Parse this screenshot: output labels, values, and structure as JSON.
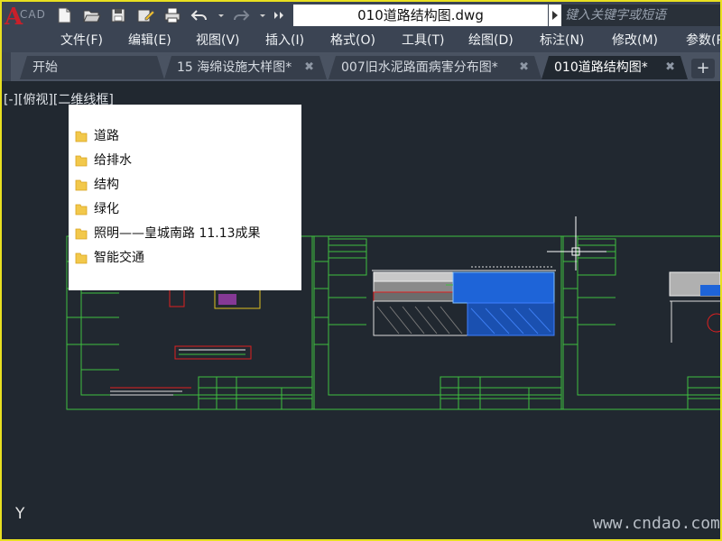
{
  "titlebar": {
    "doc_title": "010道路结构图.dwg",
    "search_placeholder": "键入关键字或短语",
    "logo_letter": "A",
    "logo_faint": "CAD",
    "quick_access": [
      "new-icon",
      "open-icon",
      "save-icon",
      "save-as-icon",
      "plot-icon",
      "undo-icon",
      "redo-icon",
      "more-icon"
    ]
  },
  "menubar": {
    "items": [
      "文件(F)",
      "编辑(E)",
      "视图(V)",
      "插入(I)",
      "格式(O)",
      "工具(T)",
      "绘图(D)",
      "标注(N)",
      "修改(M)",
      "参数(P"
    ]
  },
  "tabs": {
    "items": [
      {
        "label": "开始",
        "closable": false,
        "active": false
      },
      {
        "label": "15 海绵设施大样图*",
        "closable": true,
        "active": false
      },
      {
        "label": "007旧水泥路面病害分布图*",
        "closable": true,
        "active": false
      },
      {
        "label": "010道路结构图*",
        "closable": true,
        "active": true
      }
    ],
    "close_glyph": "✖",
    "add_glyph": "+"
  },
  "canvas": {
    "viewport_label": "[-][俯视][二维线框]",
    "ucs_axis": "Y",
    "watermark": "www.cndao.com"
  },
  "popup": {
    "folders": [
      "道路",
      "给排水",
      "结构",
      "绿化",
      "照明——皇城南路 11.13成果",
      "智能交通"
    ]
  },
  "colors": {
    "canvas_bg": "#212830",
    "titlebar_bg": "#3b4453",
    "frame_border": "#e8e020",
    "drawing_green": "#3fbf3f",
    "drawing_blue": "#1e64d8",
    "drawing_red": "#e02020"
  }
}
